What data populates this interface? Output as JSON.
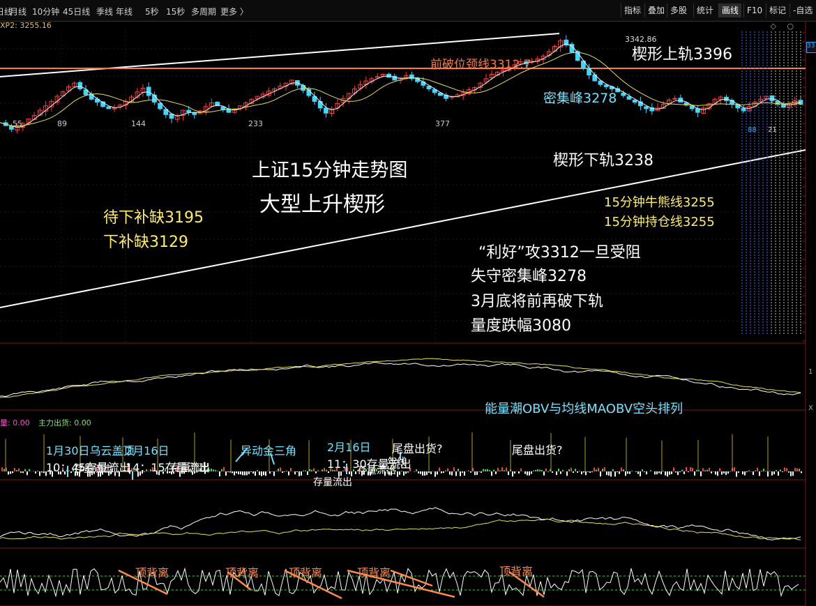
{
  "toolbar": {
    "periods": [
      "日线",
      "月线",
      "10分钟",
      "45日线",
      "季线",
      "年线",
      "5秒",
      "15秒",
      "多周期",
      "更多 〉"
    ],
    "tools": [
      "指标",
      "叠加",
      "多股",
      "统计",
      "画线",
      "F10",
      "标记",
      "-自选"
    ],
    "active_tool": "画线"
  },
  "header": {
    "indicator_readout": "XP2: 3255.16",
    "window_icons": "◇ ○",
    "side_tag": "33",
    "right_axis_mark": "1",
    "right_axis_mark2": "X"
  },
  "main_panel": {
    "title": "上证15分钟走势图",
    "subtitle": "大型上升楔形",
    "peak_value": "3342.86",
    "neckline_label": "前破位颈线3312.7",
    "upper_rail_label": "楔形上轨3396",
    "dense_peak_label": "密集峰3278",
    "lower_rail_label": "楔形下轨3238",
    "bull_bear_label": "15分钟牛熊线3255",
    "position_label": "15分钟持仓线3255",
    "gap1": "待下补缺3195",
    "gap2": "下补缺3129",
    "commentary": [
      "“利好”攻3312一旦受阻",
      "失守密集峰3278",
      "3月底将前再破下轨",
      "量度跌幅3080"
    ],
    "bar_numbers": [
      "55",
      "89",
      "144",
      "233",
      "377"
    ],
    "right_marks": [
      "88",
      "21"
    ]
  },
  "obv_panel": {
    "label": "能量潮OBV与均线MAOBV空头排列"
  },
  "flow_panel": {
    "legend_a": "量: 0.00",
    "legend_b": "主力出货: 0.00",
    "annotations": [
      {
        "line1": "1月30日乌云盖顶",
        "line2": "10：45存量流出"
      },
      {
        "line1": "2月16日",
        "line2": "14：15存量流出"
      },
      {
        "line1": "异动金三角",
        "line2": ""
      },
      {
        "line1": "2月16日",
        "line2": "11：30存量流出"
      },
      {
        "line1": "尾盘出货?",
        "line2": ""
      },
      {
        "line1": "尾盘出货?",
        "line2": ""
      }
    ],
    "overlap_texts": [
      "存量流出",
      "存量流出",
      "存量流出",
      "存量流出",
      "年线"
    ]
  },
  "osc_panel": {
    "divergence_labels": [
      "顶背离",
      "顶背离",
      "顶背离",
      "顶背离",
      "顶背离"
    ]
  },
  "colors": {
    "up": "#ff3b3b",
    "down": "#3fd6ff",
    "ma_white": "#f0f0f0",
    "ma_yellow": "#e8e050",
    "neckline": "#ff7a3c",
    "annot_yellow": "#ffee66",
    "annot_cyan": "#6fe3ff",
    "annot_orange": "#ff8a4a"
  },
  "chart_data": {
    "type": "candlestick",
    "title": "上证15分钟走势图",
    "subtitle": "大型上升楔形",
    "peak": 3342.86,
    "levels": {
      "neckline": 3312.7,
      "upper_rail": 3396,
      "dense_peak": 3278,
      "lower_rail": 3238,
      "bull_bear": 3255,
      "position": 3255,
      "gap_1": 3195,
      "gap_2": 3129,
      "target": 3080
    },
    "close_path": [
      3230,
      3226,
      3221,
      3224,
      3229,
      3235,
      3240,
      3247,
      3253,
      3259,
      3266,
      3272,
      3279,
      3284,
      3276,
      3268,
      3262,
      3258,
      3252,
      3249,
      3250,
      3254,
      3259,
      3265,
      3272,
      3277,
      3267,
      3258,
      3249,
      3241,
      3236,
      3240,
      3247,
      3244,
      3241,
      3246,
      3252,
      3257,
      3253,
      3248,
      3244,
      3249,
      3253,
      3257,
      3262,
      3266,
      3269,
      3273,
      3276,
      3280,
      3284,
      3288,
      3281,
      3274,
      3267,
      3259,
      3250,
      3243,
      3249,
      3256,
      3263,
      3270,
      3276,
      3282,
      3287,
      3290,
      3293,
      3296,
      3292,
      3288,
      3291,
      3294,
      3290,
      3286,
      3281,
      3276,
      3271,
      3267,
      3263,
      3266,
      3268,
      3271,
      3275,
      3278,
      3284,
      3290,
      3296,
      3299,
      3302,
      3306,
      3309,
      3313,
      3311,
      3314,
      3317,
      3321,
      3327,
      3334,
      3342,
      3336,
      3326,
      3315,
      3304,
      3295,
      3287,
      3282,
      3279,
      3276,
      3272,
      3267,
      3262,
      3258,
      3253,
      3249,
      3246,
      3250,
      3255,
      3261,
      3263,
      3258,
      3254,
      3249,
      3244,
      3250,
      3256,
      3262,
      3265,
      3260,
      3255,
      3250,
      3246,
      3252,
      3258,
      3262,
      3266,
      3260,
      3255,
      3251,
      3256,
      3260,
      3255
    ]
  }
}
